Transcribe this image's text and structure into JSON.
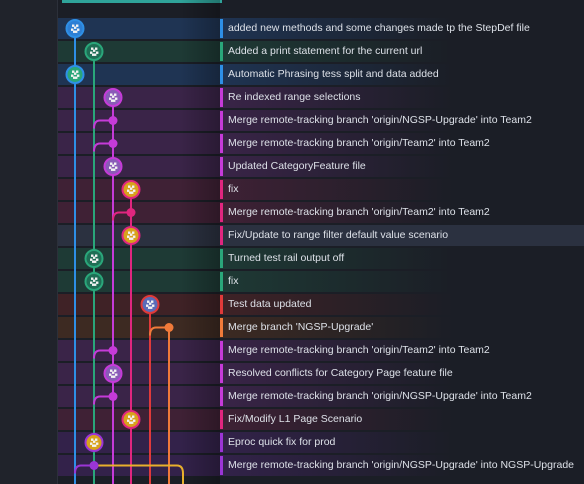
{
  "commits": [
    {
      "message": "added new methods and some changes made tp the StepDef file",
      "color": "#2e8fe6",
      "lane": 0,
      "node": "avatar",
      "avatar_bg": "#2d7fd4",
      "row_tint": "#1f3453"
    },
    {
      "message": "Added a print statement for the current url",
      "color": "#2aa67a",
      "lane": 1,
      "node": "avatar",
      "avatar_bg": "#1f6e55",
      "row_tint": "#1e3a35"
    },
    {
      "message": "Automatic Phrasing tess split and data added",
      "color": "#2e8fe6",
      "lane": 0,
      "node": "avatar",
      "avatar_bg": "#2aa67a",
      "row_tint": "#1f3453"
    },
    {
      "message": "Re indexed range selections",
      "color": "#c53bd8",
      "lane": 2,
      "node": "avatar",
      "avatar_bg": "#8a5bb8",
      "row_tint": "#3a2448"
    },
    {
      "message": "Merge remote-tracking branch 'origin/NGSP-Upgrade' into Team2",
      "color": "#c53bd8",
      "lane": 2,
      "node": "dot",
      "avatar_bg": "#c53bd8",
      "row_tint": "#3a2448"
    },
    {
      "message": "Merge remote-tracking branch 'origin/Team2' into Team2",
      "color": "#c53bd8",
      "lane": 2,
      "node": "dot",
      "avatar_bg": "#c53bd8",
      "row_tint": "#3a2448"
    },
    {
      "message": "Updated CategoryFeature file",
      "color": "#c53bd8",
      "lane": 2,
      "node": "avatar",
      "avatar_bg": "#8a5bb8",
      "row_tint": "#3a2448"
    },
    {
      "message": "fix",
      "color": "#e0267f",
      "lane": 3,
      "node": "avatar",
      "avatar_bg": "#d8a21c",
      "row_tint": "#3f2135"
    },
    {
      "message": "Merge remote-tracking branch 'origin/Team2' into Team2",
      "color": "#e0267f",
      "lane": 3,
      "node": "dot",
      "avatar_bg": "#e0267f",
      "row_tint": "#3f2135"
    },
    {
      "message": "Fix/Update to range filter default value scenario",
      "color": "#e0267f",
      "lane": 3,
      "node": "avatar",
      "avatar_bg": "#d8a21c",
      "row_tint": "#3f2135"
    },
    {
      "message": "Turned test rail output off",
      "color": "#2aa67a",
      "lane": 1,
      "node": "avatar",
      "avatar_bg": "#1f6e55",
      "row_tint": "#1e3a35"
    },
    {
      "message": "fix",
      "color": "#2aa67a",
      "lane": 1,
      "node": "avatar",
      "avatar_bg": "#1f6e55",
      "row_tint": "#1e3a35"
    },
    {
      "message": "Test data updated",
      "color": "#e03a3a",
      "lane": 4,
      "node": "avatar",
      "avatar_bg": "#5b6bb8",
      "row_tint": "#3f2226"
    },
    {
      "message": "Merge branch 'NGSP-Upgrade'",
      "color": "#f07a3a",
      "lane": 5,
      "node": "dot",
      "avatar_bg": "#f07a3a",
      "row_tint": "#3d2a22"
    },
    {
      "message": "Merge remote-tracking branch 'origin/Team2' into Team2",
      "color": "#c53bd8",
      "lane": 2,
      "node": "dot",
      "avatar_bg": "#c53bd8",
      "row_tint": "#3a2448"
    },
    {
      "message": "Resolved conflicts for Category Page feature file",
      "color": "#c53bd8",
      "lane": 2,
      "node": "avatar",
      "avatar_bg": "#8a5bb8",
      "row_tint": "#3a2448"
    },
    {
      "message": "Merge remote-tracking branch 'origin/NGSP-Upgrade' into Team2",
      "color": "#c53bd8",
      "lane": 2,
      "node": "dot",
      "avatar_bg": "#c53bd8",
      "row_tint": "#3a2448"
    },
    {
      "message": "Fix/Modify L1 Page Scenario",
      "color": "#e0267f",
      "lane": 3,
      "node": "avatar",
      "avatar_bg": "#d8a21c",
      "row_tint": "#3f2135"
    },
    {
      "message": "Eproc quick fix for prod",
      "color": "#9b35d6",
      "lane": 1,
      "node": "avatar",
      "avatar_bg": "#d8a21c",
      "row_tint": "#33224a"
    },
    {
      "message": "Merge remote-tracking branch 'origin/NGSP-Upgrade' into NGSP-Upgrade",
      "color": "#9b35d6",
      "lane": 1,
      "node": "dot",
      "avatar_bg": "#9b35d6",
      "row_tint": "#33224a"
    }
  ],
  "selected_row": 9,
  "lanes": [
    {
      "color": "#2e8fe6"
    },
    {
      "color": "#2aa67a"
    },
    {
      "color": "#c53bd8"
    },
    {
      "color": "#e0267f"
    },
    {
      "color": "#e03a3a"
    },
    {
      "color": "#f07a3a"
    }
  ],
  "lower_lanes": [
    {
      "color": "#9b35d6"
    },
    {
      "color": "#e8b02c"
    }
  ]
}
